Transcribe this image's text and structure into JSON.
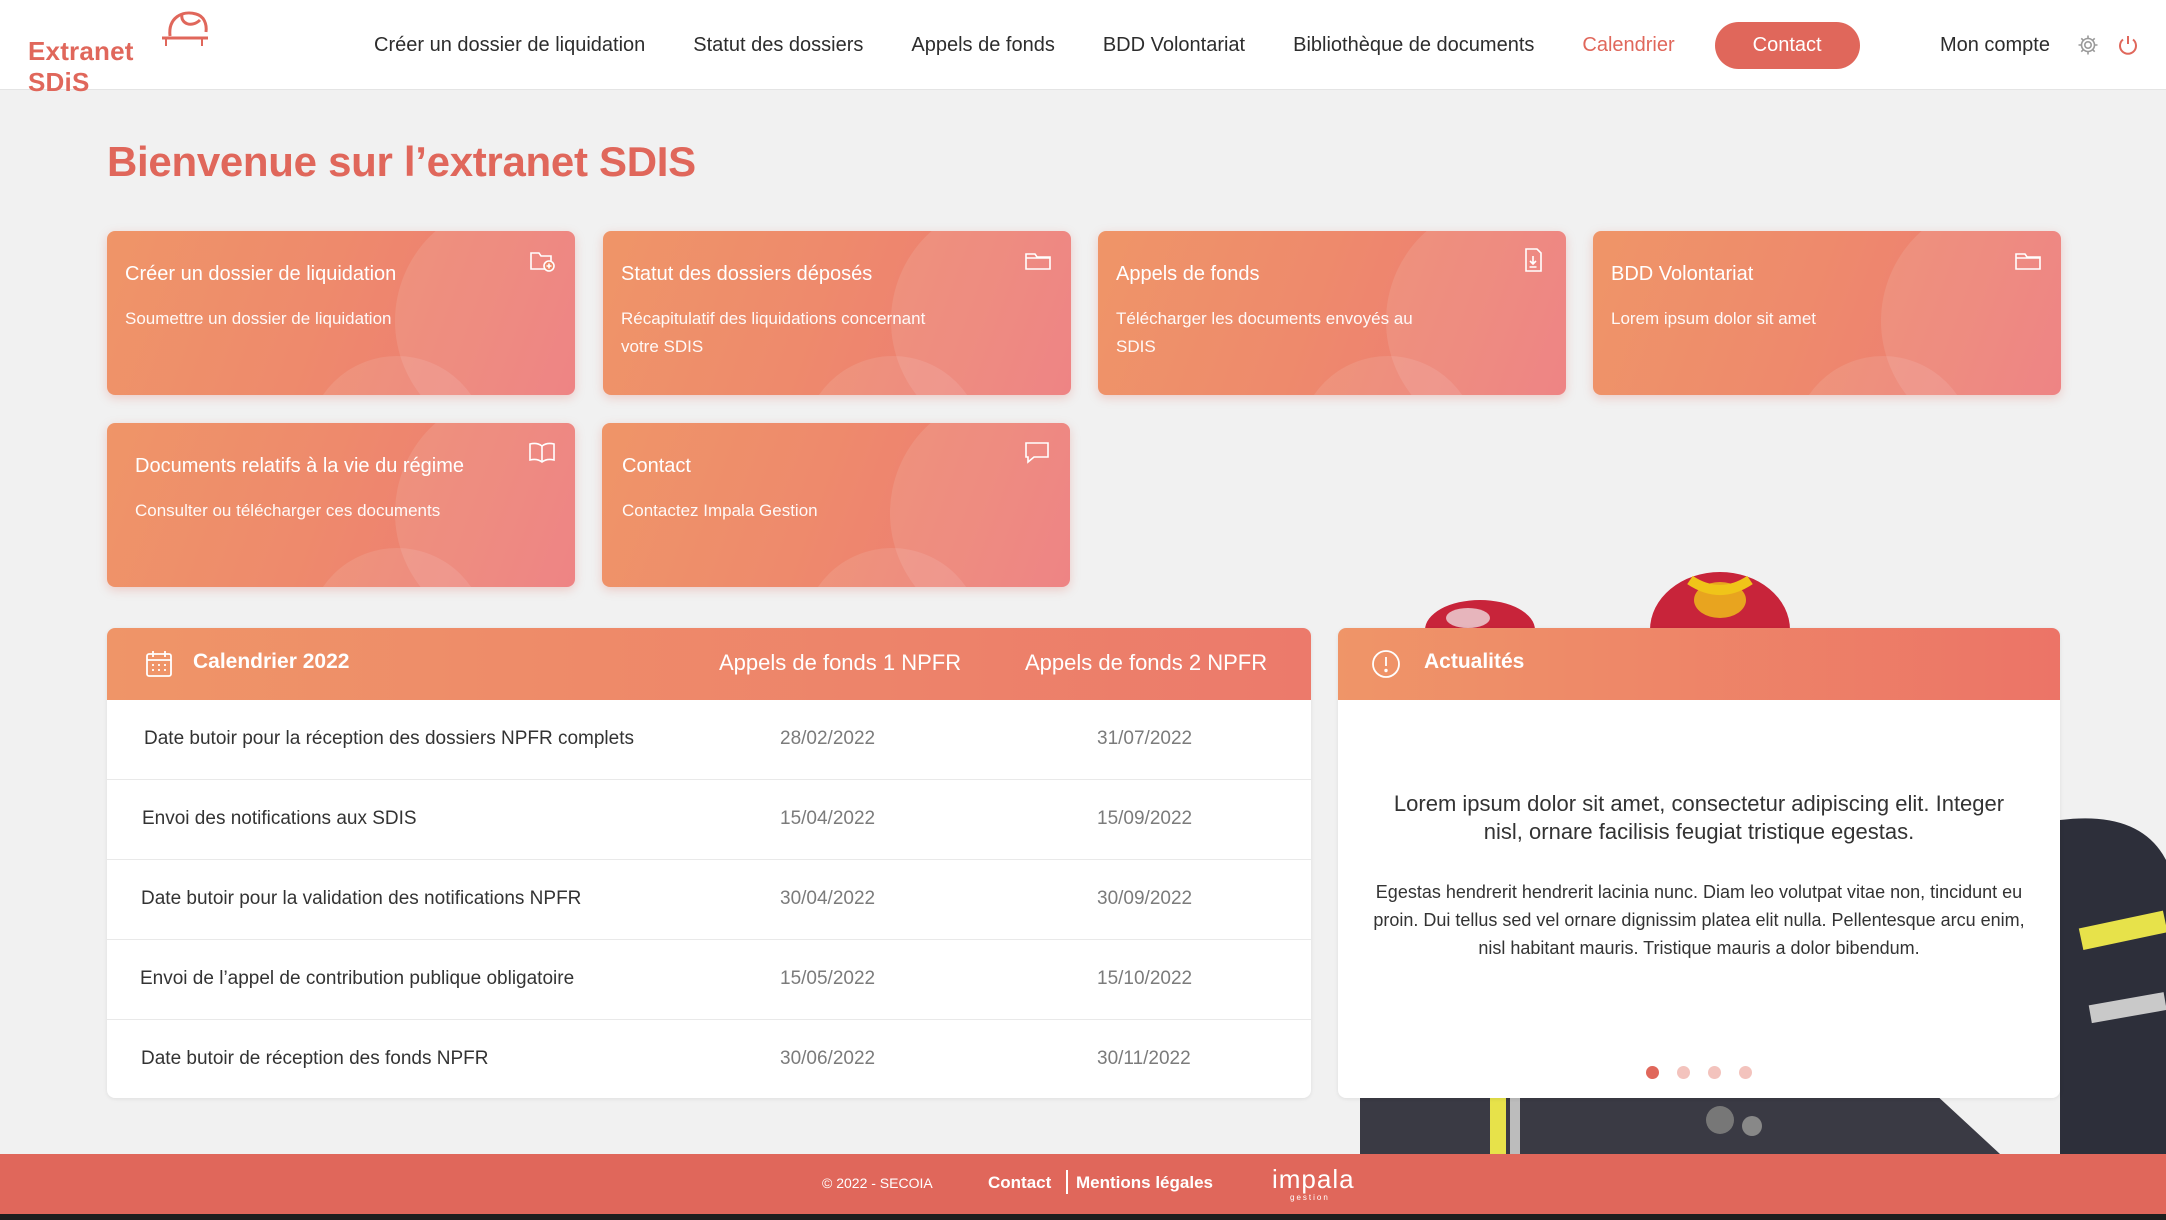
{
  "header": {
    "logo_text": "Extranet SDiS",
    "nav": [
      {
        "label": "Créer un dossier de liquidation"
      },
      {
        "label": "Statut des dossiers"
      },
      {
        "label": "Appels de fonds"
      },
      {
        "label": "BDD Volontariat"
      },
      {
        "label": "Bibliothèque de documents"
      },
      {
        "label": "Calendrier",
        "active": true
      }
    ],
    "contact_label": "Contact",
    "account_label": "Mon compte"
  },
  "welcome": "Bienvenue sur l’extranet SDIS",
  "cards": [
    {
      "title": "Créer un dossier de liquidation",
      "desc": "Soumettre un dossier de liquidation",
      "icon": "folder-add-icon"
    },
    {
      "title": "Statut des dossiers déposés",
      "desc": "Récapitulatif des liquidations concernant votre SDIS",
      "icon": "folder-icon"
    },
    {
      "title": "Appels de fonds",
      "desc": "Télécharger les documents envoyés au SDIS",
      "icon": "file-download-icon"
    },
    {
      "title": "BDD Volontariat",
      "desc": "Lorem ipsum dolor sit amet",
      "icon": "folder-icon"
    },
    {
      "title": "Documents relatifs à la vie du régime",
      "desc": "Consulter ou télécharger ces documents",
      "icon": "book-icon"
    },
    {
      "title": "Contact",
      "desc": "Contactez Impala Gestion",
      "icon": "chat-icon"
    }
  ],
  "calendar": {
    "title": "Calendrier 2022",
    "col1": "Appels de fonds 1 NPFR",
    "col2": "Appels de fonds 2 NPFR",
    "rows": [
      {
        "label": "Date butoir pour la réception des dossiers NPFR complets",
        "d1": "28/02/2022",
        "d2": "31/07/2022"
      },
      {
        "label": "Envoi des notifications aux SDIS",
        "d1": "15/04/2022",
        "d2": "15/09/2022"
      },
      {
        "label": "Date butoir pour la validation des notifications NPFR",
        "d1": "30/04/2022",
        "d2": "30/09/2022"
      },
      {
        "label": "Envoi de l’appel de contribution publique obligatoire",
        "d1": "15/05/2022",
        "d2": "15/10/2022"
      },
      {
        "label": "Date butoir de réception des fonds NPFR",
        "d1": "30/06/2022",
        "d2": "30/11/2022"
      }
    ]
  },
  "news": {
    "title": "Actualités",
    "lead": "Lorem ipsum dolor sit amet, consectetur adipiscing elit. Integer nisl, ornare facilisis feugiat tristique egestas.",
    "body": "Egestas hendrerit hendrerit lacinia nunc. Diam leo volutpat vitae non, tincidunt eu proin. Dui tellus sed vel ornare dignissim platea elit nulla. Pellentesque arcu enim, nisl habitant mauris. Tristique mauris a dolor bibendum.",
    "slide_count": 4,
    "active_slide": 1
  },
  "footer": {
    "copyright": "© 2022 - SECOIA",
    "contact": "Contact",
    "legal": "Mentions légales",
    "logo": "impala",
    "logo_sub": "gestion"
  },
  "colors": {
    "accent": "#e0675b",
    "gradient_start": "#ef9568",
    "gradient_end": "#ec7777"
  }
}
